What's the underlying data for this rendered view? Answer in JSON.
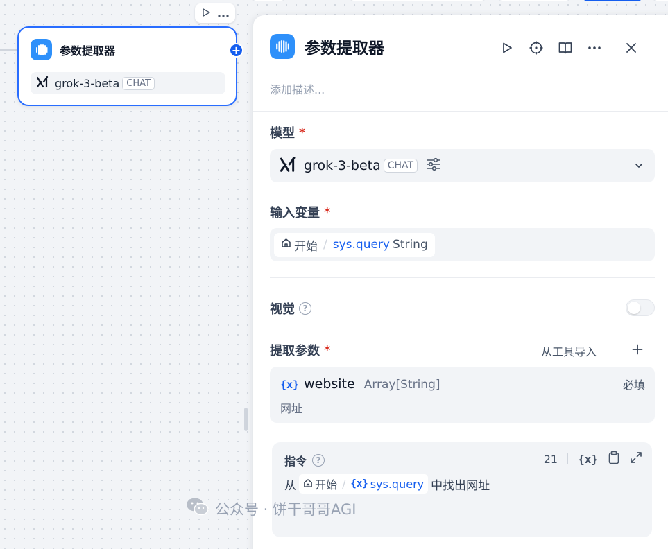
{
  "colors": {
    "accent": "#296dff",
    "handle": "#155eef",
    "app_icon": "#2e90fa",
    "required": "#d92d20"
  },
  "node": {
    "title": "参数提取器",
    "model_name": "grok-3-beta",
    "model_tag": "CHAT",
    "toolbar_icons": [
      "play-icon",
      "more-icon"
    ]
  },
  "panel": {
    "title": "参数提取器",
    "description_placeholder": "添加描述...",
    "header_icons": [
      "play-icon",
      "crosshair-icon",
      "book-icon",
      "more-icon",
      "close-icon"
    ],
    "model": {
      "label": "模型",
      "required_mark": "*",
      "name": "grok-3-beta",
      "tag": "CHAT"
    },
    "input_var": {
      "label": "输入变量",
      "required_mark": "*",
      "node": "开始",
      "separator": "/",
      "var": "sys.query",
      "type": "String"
    },
    "vision": {
      "label": "视觉",
      "help": "?",
      "enabled": false
    },
    "params": {
      "label": "提取参数",
      "required_mark": "*",
      "import_label": "从工具导入",
      "add_label": "+",
      "items": [
        {
          "var_icon": "{x}",
          "name": "website",
          "type": "Array[String]",
          "required": "必填",
          "description": "网址"
        }
      ]
    },
    "instruction": {
      "label": "指令",
      "help": "?",
      "count": "21",
      "var_icon": "{x}",
      "text_before": "从",
      "chip_node": "开始",
      "chip_sep": "/",
      "chip_var": "sys.query",
      "text_after": "中找出网址"
    }
  },
  "watermark": {
    "text": "公众号 · 饼干哥哥AGI"
  }
}
